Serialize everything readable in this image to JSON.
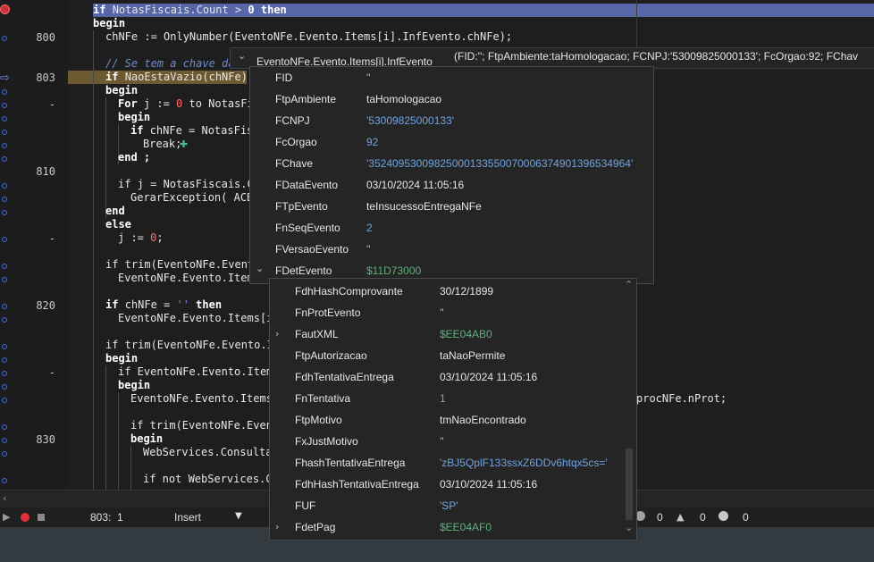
{
  "gutter": {
    "line_numbers": [
      {
        "text": "800"
      },
      {
        "text": "803"
      },
      {
        "text": "810"
      },
      {
        "text": "820"
      },
      {
        "text": "830"
      }
    ],
    "minor_marks": [
      "-",
      "-",
      "-",
      "-",
      "-",
      "-"
    ]
  },
  "code": {
    "l1": {
      "a": "if ",
      "b": "NotasFiscais.Count > ",
      "n": "0",
      "c": " then"
    },
    "l2": "begin",
    "l3": "chNFe := OnlyNumber(EventoNFe.Evento.Items[i].InfEvento.chNFe);",
    "l5": "// Se tem a chave da",
    "l6": {
      "a": "if ",
      "b": "NaoEstaVazio(chNFe)"
    },
    "l7": "begin",
    "l8": {
      "a": "For ",
      "b": "j := ",
      "n": "0",
      "c": " to NotasFi"
    },
    "l9": "begin",
    "l10": {
      "a": "if ",
      "b": "chNFe = NotasFis"
    },
    "l11": "Break;",
    "l12": "end ;",
    "l14": "if j = NotasFiscais.C",
    "l15": "GerarException( ACB",
    "l16": "end",
    "l17": "else",
    "l18": {
      "a": "j := ",
      "n": "0",
      "c": ";"
    },
    "l20": "if trim(EventoNFe.Event",
    "l21": "EventoNFe.Evento.Item",
    "l23": {
      "a": "if ",
      "b": "chNFe = ",
      "s": "''",
      "c": " then"
    },
    "l24": "EventoNFe.Evento.Items[i",
    "l26": "if trim(EventoNFe.Evento.I",
    "l27": "begin",
    "l28": "if EventoNFe.Evento.Item",
    "l29": "begin",
    "l30": "EventoNFe.Evento.Items",
    "l30b": "procNFe.nProt;",
    "l32": "if trim(EventoNFe.Even",
    "l33": "begin",
    "l34": "WebServices.Consulta",
    "l36": "if not WebServices.C"
  },
  "tooltip": {
    "expr": "EventoNFe.Evento.Items[i].InfEvento",
    "value": "(FID:''; FtpAmbiente:taHomologacao; FCNPJ:'53009825000133'; FcOrgao:92; FChav"
  },
  "popup1": {
    "rows": [
      {
        "name": "FID",
        "value": "''",
        "style": "v-gray"
      },
      {
        "name": "FtpAmbiente",
        "value": "taHomologacao",
        "style": "v-plain"
      },
      {
        "name": "FCNPJ",
        "value": "'53009825000133'",
        "style": "v-blue"
      },
      {
        "name": "FcOrgao",
        "value": "92",
        "style": "v-blue"
      },
      {
        "name": "FChave",
        "value": "'35240953009825000133550070006374901396534964'",
        "style": "v-blue"
      },
      {
        "name": "FDataEvento",
        "value": "03/10/2024 11:05:16",
        "style": "v-plain"
      },
      {
        "name": "FTpEvento",
        "value": "teInsucessoEntregaNFe",
        "style": "v-plain"
      },
      {
        "name": "FnSeqEvento",
        "value": "2",
        "style": "v-blue"
      },
      {
        "name": "FVersaoEvento",
        "value": "''",
        "style": "v-gray"
      },
      {
        "name": "FDetEvento",
        "value": "$11D73000",
        "style": "v-green"
      }
    ]
  },
  "popup2": {
    "rows": [
      {
        "name": "FdhHashComprovante",
        "value": "30/12/1899",
        "style": "v-plain"
      },
      {
        "name": "FnProtEvento",
        "value": "''",
        "style": "v-gray"
      },
      {
        "name": "FautXML",
        "value": "$EE04AB0",
        "style": "v-green",
        "expand": true
      },
      {
        "name": "FtpAutorizacao",
        "value": "taNaoPermite",
        "style": "v-plain"
      },
      {
        "name": "FdhTentativaEntrega",
        "value": "03/10/2024 11:05:16",
        "style": "v-plain"
      },
      {
        "name": "FnTentativa",
        "value": "1",
        "style": "v-blue"
      },
      {
        "name": "FtpMotivo",
        "value": "tmNaoEncontrado",
        "style": "v-plain"
      },
      {
        "name": "FxJustMotivo",
        "value": "''",
        "style": "v-gray"
      },
      {
        "name": "FhashTentativaEntrega",
        "value": "'zBJ5QplF133ssxZ6DDv6htqx5cs='",
        "style": "v-blue"
      },
      {
        "name": "FdhHashTentativaEntrega",
        "value": "03/10/2024 11:05:16",
        "style": "v-plain"
      },
      {
        "name": "FUF",
        "value": "'SP'",
        "style": "v-blue"
      },
      {
        "name": "FdetPag",
        "value": "$EE04AF0",
        "style": "v-green",
        "expand": true
      }
    ]
  },
  "status": {
    "position": "803:",
    "col": "1",
    "mode": "Insert",
    "errors": "0",
    "warnings": "0",
    "hints": "0"
  },
  "colors": {
    "highlight": "#5766a6",
    "exec": "#6e5a32",
    "accent_blue": "#6fa3e0",
    "accent_green": "#5fb07a"
  }
}
